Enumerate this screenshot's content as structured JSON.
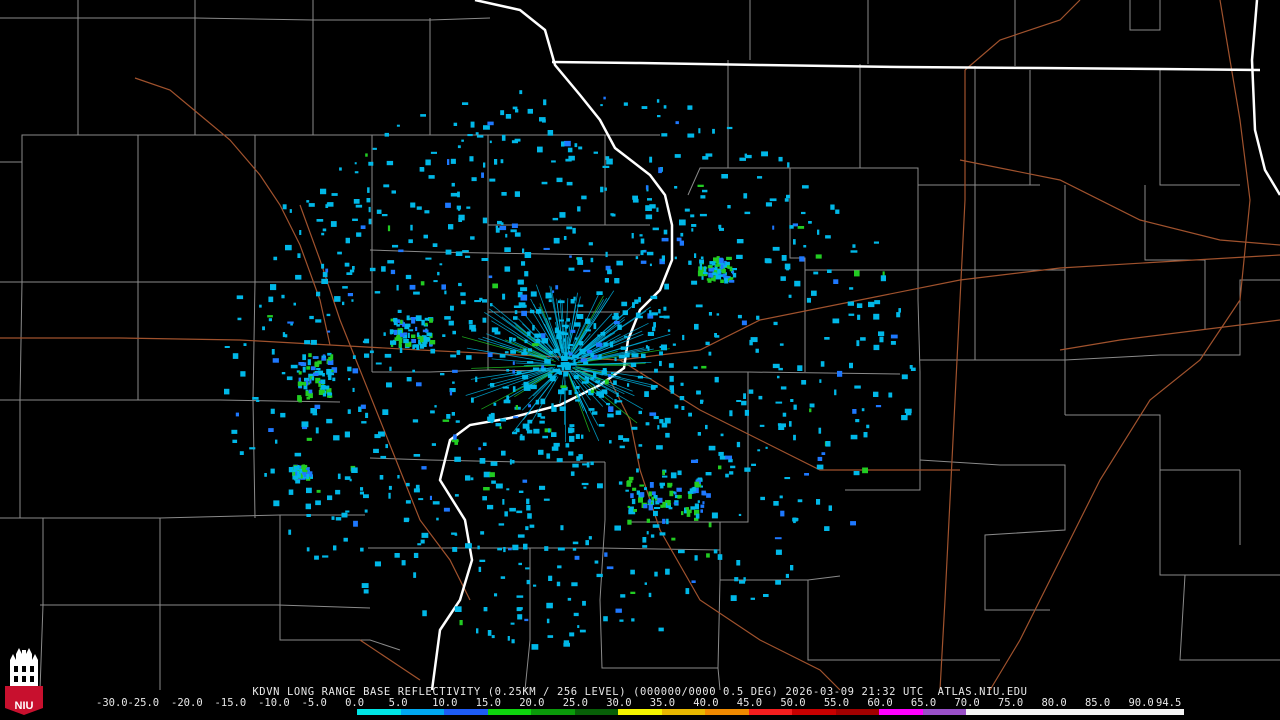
{
  "product": {
    "caption": "KDVN LONG RANGE BASE REFLECTIVITY (0.25KM / 256 LEVEL) (000000/0000 0.5 DEG) 2026-03-09 21:32 UTC  ATLAS.NIU.EDU"
  },
  "logo": {
    "text": "NIU",
    "color": "#c8102e"
  },
  "legend": {
    "ticks": [
      "-30.0",
      "-25.0",
      "-20.0",
      "-15.0",
      "-10.0",
      "-5.0",
      "0.0",
      "5.0",
      "10.0",
      "15.0",
      "20.0",
      "25.0",
      "30.0",
      "35.0",
      "40.0",
      "45.0",
      "50.0",
      "55.0",
      "60.0",
      "65.0",
      "70.0",
      "75.0",
      "80.0",
      "85.0",
      "90.0",
      "94.5"
    ],
    "colors": [
      "#000000",
      "#000000",
      "#000000",
      "#000000",
      "#000000",
      "#000000",
      "#00e5e5",
      "#00a8f0",
      "#1d5cf5",
      "#0ed40e",
      "#0a9a0a",
      "#075f07",
      "#f5f500",
      "#e8b800",
      "#f08a00",
      "#f51e1e",
      "#c80000",
      "#a00000",
      "#ff00ff",
      "#9a50c8",
      "#f5f5f5",
      "#f5f5f5",
      "#f5f5f5",
      "#f5f5f5",
      "#f5f5f5"
    ]
  },
  "map_style": {
    "county_line": "#8a8a8a",
    "highway": "#a0522d",
    "river": "#ffffff",
    "echo_light": "#00b8e8",
    "echo_medium": "#1e78ff",
    "echo_strong": "#22cc22"
  }
}
